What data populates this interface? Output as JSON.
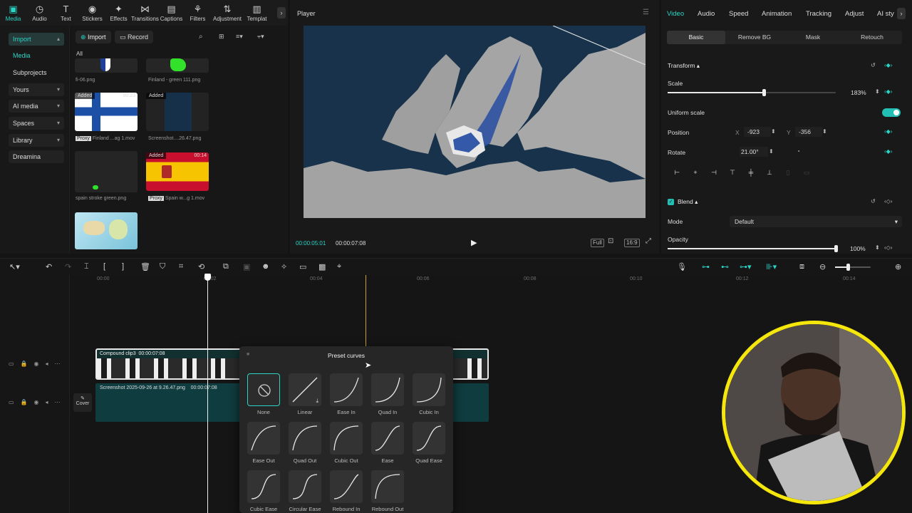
{
  "toolbar": {
    "items": [
      {
        "label": "Media",
        "icon": "media-icon"
      },
      {
        "label": "Audio",
        "icon": "audio-icon"
      },
      {
        "label": "Text",
        "icon": "text-icon"
      },
      {
        "label": "Stickers",
        "icon": "stickers-icon"
      },
      {
        "label": "Effects",
        "icon": "effects-icon"
      },
      {
        "label": "Transitions",
        "icon": "transitions-icon"
      },
      {
        "label": "Captions",
        "icon": "captions-icon"
      },
      {
        "label": "Filters",
        "icon": "filters-icon"
      },
      {
        "label": "Adjustment",
        "icon": "adjustment-icon"
      },
      {
        "label": "Templat",
        "icon": "templates-icon"
      }
    ]
  },
  "sidebar": {
    "items": [
      {
        "label": "Import"
      },
      {
        "label": "Media"
      },
      {
        "label": "Subprojects"
      },
      {
        "label": "Yours"
      },
      {
        "label": "AI media"
      },
      {
        "label": "Spaces"
      },
      {
        "label": "Library"
      },
      {
        "label": "Dreamina"
      }
    ]
  },
  "media": {
    "import_label": "Import",
    "record_label": "Record",
    "filter_all": "All",
    "items": [
      {
        "name": "fi-06.png",
        "added": "",
        "duration": "",
        "proxy": ""
      },
      {
        "name": "Finland - green 111.png",
        "added": "",
        "duration": "",
        "proxy": ""
      },
      {
        "name": "Finland ...ag 1.mov",
        "added": "Added",
        "duration": "00:23",
        "proxy": "Proxy"
      },
      {
        "name": "Screenshot....26.47.png",
        "added": "Added",
        "duration": "",
        "proxy": ""
      },
      {
        "name": "spain stroke green.png",
        "added": "",
        "duration": "",
        "proxy": ""
      },
      {
        "name": "Spain w...g 1.mov",
        "added": "Added",
        "duration": "00:14",
        "proxy": "Proxy"
      }
    ]
  },
  "player": {
    "title": "Player",
    "current_time": "00:00:05:01",
    "total_time": "00:00:07:08",
    "ctl_full": "Full",
    "ctl_ratio": "16:9"
  },
  "inspector": {
    "tabs": [
      "Video",
      "Audio",
      "Speed",
      "Animation",
      "Tracking",
      "Adjust",
      "AI sty"
    ],
    "subtabs": [
      "Basic",
      "Remove BG",
      "Mask",
      "Retouch"
    ],
    "transform_label": "Transform",
    "scale_label": "Scale",
    "scale_value": "183%",
    "scale_fraction": 0.57,
    "uniform_scale_label": "Uniform scale",
    "position_label": "Position",
    "pos_x_label": "X",
    "pos_x": "-923",
    "pos_y_label": "Y",
    "pos_y": "-356",
    "rotate_label": "Rotate",
    "rotate_value": "21.00°",
    "blend_label": "Blend",
    "mode_label": "Mode",
    "mode_value": "Default",
    "opacity_label": "Opacity",
    "opacity_value": "100%",
    "opacity_fraction": 1.0
  },
  "timeline": {
    "ruler": [
      "00:00",
      "00:02",
      "00:04",
      "00:06",
      "00:08",
      "00:10",
      "00:12",
      "00:14"
    ],
    "clip1_label": "Compound clip3",
    "clip1_duration": "00:00:07:08",
    "clip2_label": "Screenshot 2025-09-26 at 9.26.47.png",
    "clip2_duration": "00:00:07:08",
    "cover_label": "Cover"
  },
  "curves": {
    "title": "Preset curves",
    "items": [
      {
        "label": "None"
      },
      {
        "label": "Linear"
      },
      {
        "label": "Ease In"
      },
      {
        "label": "Quad In"
      },
      {
        "label": "Cubic In"
      },
      {
        "label": "Ease Out"
      },
      {
        "label": "Quad Out"
      },
      {
        "label": "Cubic Out"
      },
      {
        "label": "Ease"
      },
      {
        "label": "Quad Ease"
      },
      {
        "label": "Cubic Ease"
      },
      {
        "label": "Circular Ease"
      },
      {
        "label": "Rebound In"
      },
      {
        "label": "Rebound Out"
      }
    ]
  },
  "colors": {
    "accent": "#2ad4c6",
    "webcam_ring": "#f5e60b"
  }
}
